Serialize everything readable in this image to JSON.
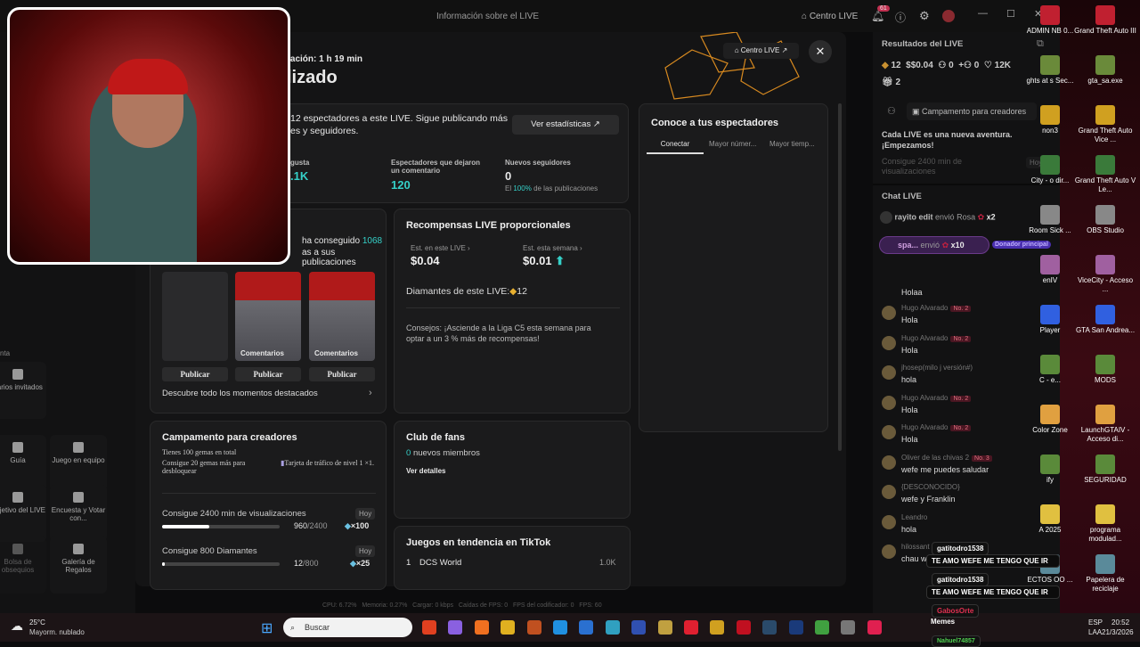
{
  "topbar": {
    "title": "Información sobre el LIVE",
    "centro_live": "Centro LIVE",
    "notif_count": "61"
  },
  "modal": {
    "duration": "ración: 1 h 19 min",
    "status": "lizado",
    "centro_live_btn": "Centro LIVE",
    "summary_line1": "12 espectadores a este LIVE. Sigue publicando más",
    "summary_line2": "es y seguidores.",
    "ver_estadisticas": "Ver estadísticas",
    "stats": [
      {
        "label": "gusta",
        "value": ".1K"
      },
      {
        "label": "Espectadores que dejaron un comentario",
        "value": "120"
      },
      {
        "label": "Nuevos seguidores",
        "value": "0",
        "sub_pre": "El",
        "sub_pct": "100%",
        "sub_post": "de las publicaciones"
      }
    ],
    "highlights": {
      "line1_pre": "ha conseguido",
      "line1_num": "1068",
      "line2": "as a sus publicaciones",
      "thumb_labels": [
        "",
        "Comentarios",
        "Comentarios"
      ],
      "publish": "Publicar",
      "discover": "Descubre todo los momentos destacados"
    },
    "rewards": {
      "title": "Recompensas LIVE proporcionales",
      "est_live_label": "Est. en este LIVE",
      "est_live": "$0.04",
      "est_week_label": "Est. esta semana",
      "est_week": "$0.01",
      "diamonds": "Diamantes de este LIVE:",
      "diamonds_val": "12",
      "tip": "Consejos: ¡Asciende a la Liga C5 esta semana para optar a un 3 % más de recompensas!"
    },
    "viewers": {
      "title": "Conoce a tus espectadores",
      "tabs": [
        "Conectar",
        "Mayor númer...",
        "Mayor tiemp..."
      ]
    },
    "camp": {
      "title": "Campamento para creadores",
      "gems": "Tienes 100 gemas en total",
      "unlock": "Consigue 20 gemas más para desbloquear",
      "card": "Tarjeta de tráfico de nivel 1 ×1.",
      "tasks": [
        {
          "label": "Consigue 2400 min de visualizaciones",
          "tag": "Hoy",
          "cur": "960",
          "total": "/2400",
          "reward": "×100",
          "progress": 0.4
        },
        {
          "label": "Consigue 800 Diamantes",
          "tag": "Hoy",
          "cur": "12",
          "total": "/800",
          "reward": "×25",
          "progress": 0.015
        }
      ]
    },
    "fans": {
      "title": "Club de fans",
      "count": "0",
      "members": "nuevos miembros",
      "details": "Ver detalles"
    },
    "trending": {
      "title": "Juegos en tendencia en TikTok",
      "rank": "1",
      "game": "DCS World",
      "value": "1.0K"
    }
  },
  "sidebar": {
    "section": "nta",
    "tools": [
      "Varios invitados",
      "Guía",
      "Juego en equipo",
      "Objetivo del LIVE",
      "Encuesta y Votar con...",
      "Bolsa de obsequios",
      "Galería de Regalos"
    ]
  },
  "results": {
    "title": "Resultados del LIVE",
    "diamonds": "12",
    "money": "$0.04",
    "viewers": "0",
    "followers": "0",
    "likes": "12K",
    "gifts": "2",
    "camp_btn": "Campamento para creadores",
    "adventure": "Cada LIVE es una nueva aventura. ¡Empezamos!",
    "task": "Consigue 2400 min de visualizaciones",
    "task_tag": "Hoy"
  },
  "chat": {
    "title": "Chat LIVE",
    "gift1": {
      "user": "rayito edit",
      "action": "envió Rosa",
      "count": "x2"
    },
    "gift2": {
      "user": "spa...",
      "action": "envió",
      "count": "x10",
      "badge": "Donador principal"
    },
    "messages": [
      {
        "user": "",
        "rank": "",
        "text": "Holaa"
      },
      {
        "user": "Hugo Alvarado",
        "rank": "No. 2",
        "text": "Hola"
      },
      {
        "user": "Hugo Alvarado",
        "rank": "No. 2",
        "text": "Hola"
      },
      {
        "user": "jhosep(milo j versión#)",
        "rank": "",
        "text": "hola"
      },
      {
        "user": "Hugo Alvarado",
        "rank": "No. 2",
        "text": "Hola"
      },
      {
        "user": "Hugo Alvarado",
        "rank": "No. 2",
        "text": "Hola"
      },
      {
        "user": "Oliver de las chivas 2",
        "rank": "No. 3",
        "text": "wefe me puedes saludar"
      },
      {
        "user": "{DESCONOCIDO}",
        "rank": "",
        "text": "wefe y Franklin"
      },
      {
        "user": "Leandro",
        "rank": "",
        "text": "hola"
      },
      {
        "user": "hilossant",
        "rank": "",
        "text": "chau w"
      }
    ]
  },
  "overlay": [
    {
      "user": "gatitodro1538",
      "text": "TE AMO WEFE ME TENGO QUE IR"
    },
    {
      "user": "gatitodro1538",
      "text": "TE AMO WEFE ME TENGO QUE IR"
    },
    {
      "user": "GabosOrte",
      "text": "Memes"
    },
    {
      "user": "Nahuel74857",
      "text": ""
    }
  ],
  "statusline": "CPU: 6.72%   Memoria: 0.27%   Cargar: 0 kbps   Caídas de FPS: 0   FPS del codificador: 0   FPS: 60",
  "desktop": [
    "ADMIN NB 0...",
    "Grand Theft Auto III",
    "ghts at s Sec...",
    "gta_sa.exe",
    "non3",
    "Grand Theft Auto Vice ...",
    "City - o dir...",
    "Grand Theft Auto V Le...",
    "Room Sick ...",
    "OBS Studio",
    "enIV",
    "ViceCity - Acceso ...",
    "Player",
    "GTA San Andrea...",
    "C - e...",
    "MODS",
    "Color Zone",
    "LaunchGTAIV - Acceso di...",
    "ify",
    "SEGURIDAD",
    "A 2025",
    "programa modulad...",
    "ECTOS OO ...",
    "Papelera de reciclaje"
  ],
  "taskbar": {
    "temp": "25°C",
    "weather": "Mayorm. nublado",
    "search": "Buscar",
    "lang1": "ESP",
    "lang2": "LAA",
    "time": "20:52",
    "date": "21/3/2026"
  },
  "colors": {
    "accent": "#35d0c8",
    "rank": "#e07080",
    "badge": "#5a3fd0"
  }
}
